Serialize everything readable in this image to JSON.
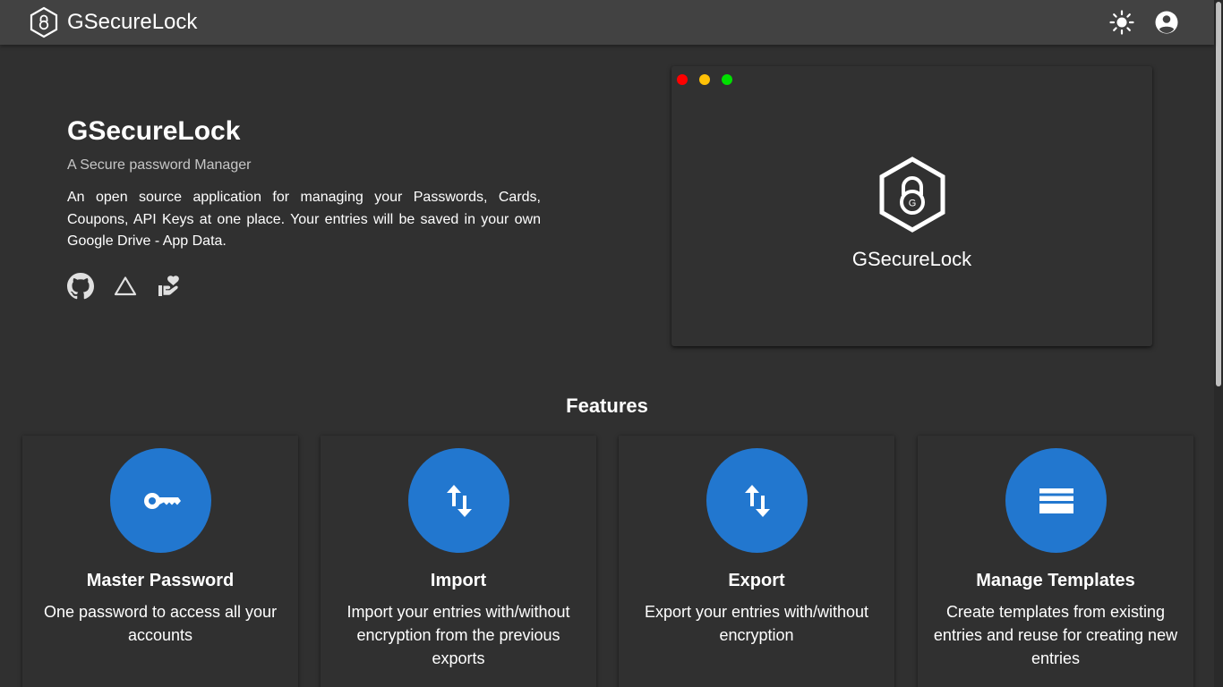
{
  "header": {
    "title": "GSecureLock",
    "logo_icon": "padlock-hexagon-icon",
    "theme_toggle_icon": "sun-icon",
    "account_icon": "account-circle-icon"
  },
  "hero": {
    "title": "GSecureLock",
    "subtitle": "A Secure password Manager",
    "description": "An open source application for managing your Passwords, Cards, Coupons, API Keys at one place. Your entries will be saved in your own Google Drive - App Data.",
    "links": [
      {
        "icon": "github-icon"
      },
      {
        "icon": "google-drive-icon"
      },
      {
        "icon": "donate-heart-hand-icon"
      }
    ]
  },
  "preview": {
    "title": "GSecureLock",
    "logo_letter": "G",
    "window_dots": [
      "#ff0000",
      "#ffc107",
      "#00e000"
    ]
  },
  "features": {
    "title": "Features",
    "accent": "#2277cf",
    "items": [
      {
        "icon": "key-icon",
        "title": "Master Password",
        "text": "One password to access all your accounts"
      },
      {
        "icon": "swap-vertical-icon",
        "title": "Import",
        "text": "Import your entries with/without encryption from the previous exports"
      },
      {
        "icon": "swap-vertical-icon",
        "title": "Export",
        "text": "Export your entries with/without encryption"
      },
      {
        "icon": "view-list-icon",
        "title": "Manage Templates",
        "text": "Create templates from existing entries and reuse for creating new entries"
      }
    ]
  }
}
